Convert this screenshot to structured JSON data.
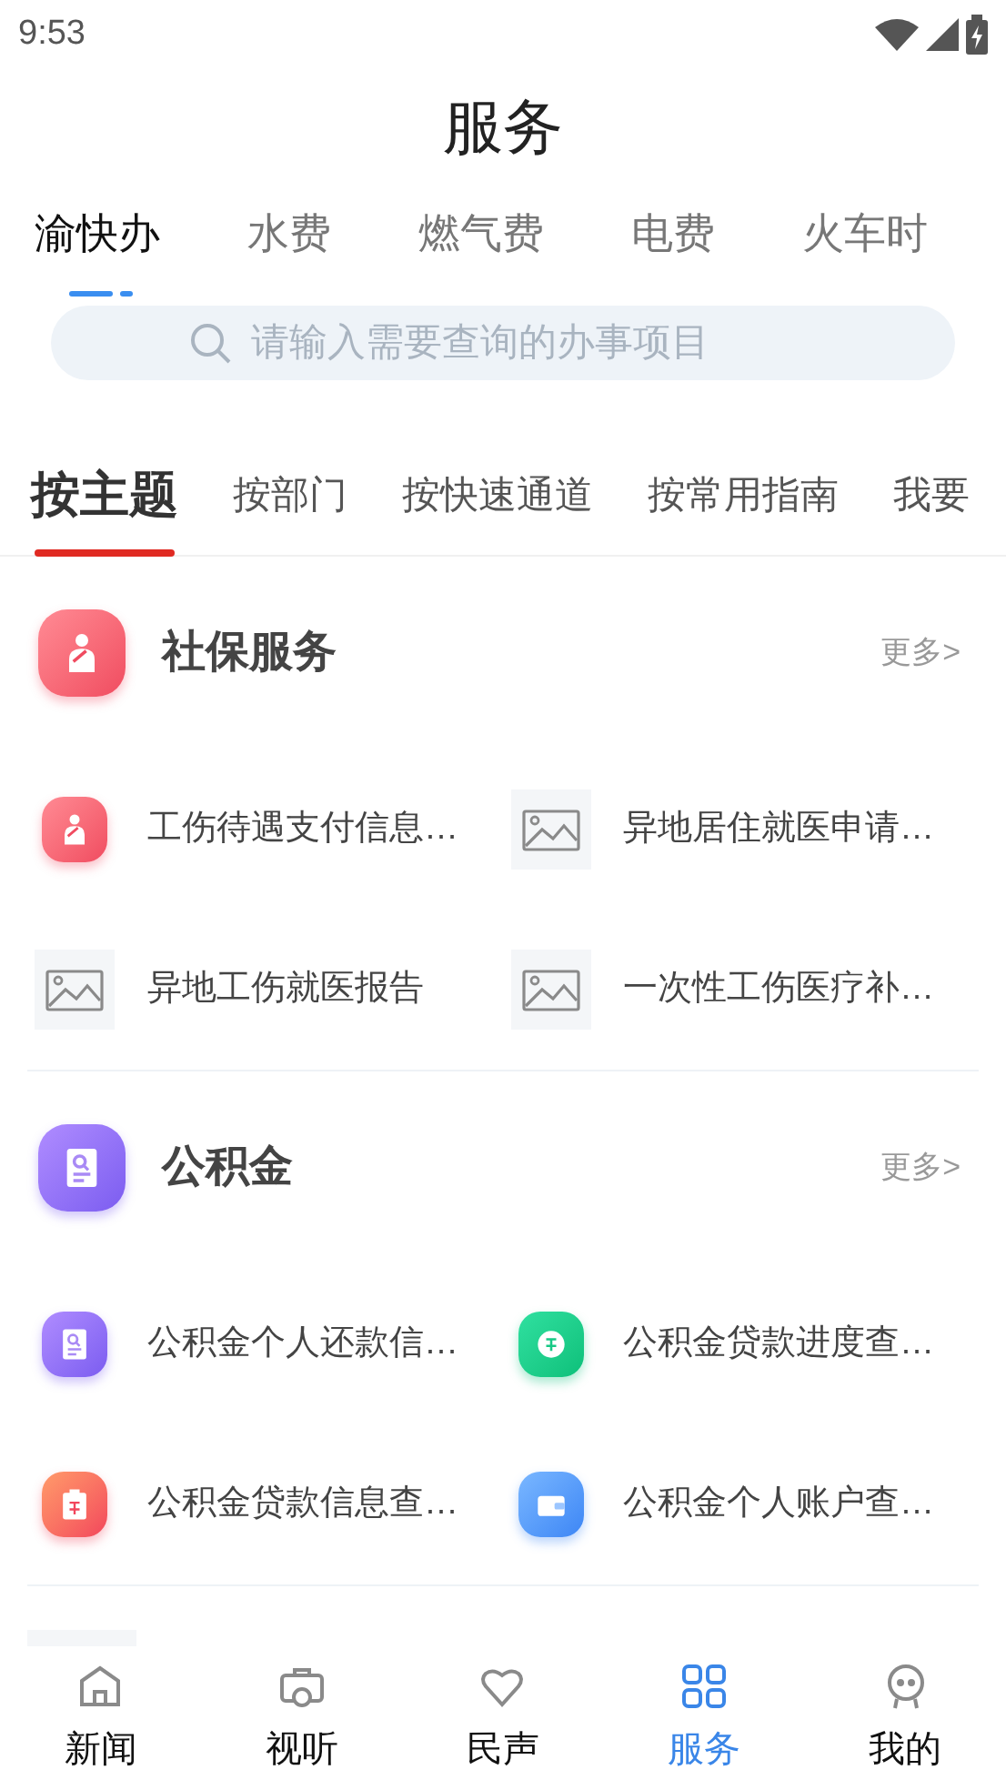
{
  "status_bar": {
    "time": "9:53"
  },
  "header": {
    "title": "服务"
  },
  "top_tabs": [
    {
      "label": "渝快办",
      "selected": true
    },
    {
      "label": "水费",
      "selected": false
    },
    {
      "label": "燃气费",
      "selected": false
    },
    {
      "label": "电费",
      "selected": false
    },
    {
      "label": "火车时",
      "selected": false
    }
  ],
  "search": {
    "placeholder": "请输入需要查询的办事项目"
  },
  "sub_tabs": [
    {
      "label": "按主题",
      "selected": true
    },
    {
      "label": "按部门",
      "selected": false
    },
    {
      "label": "按快速通道",
      "selected": false
    },
    {
      "label": "按常用指南",
      "selected": false
    },
    {
      "label": "我要",
      "selected": false
    }
  ],
  "sections": [
    {
      "title": "社保服务",
      "kind": "injury",
      "more": "更多>",
      "items": [
        {
          "label": "工伤待遇支付信息…",
          "kind": "injury"
        },
        {
          "label": "异地居住就医申请…",
          "kind": "picture"
        },
        {
          "label": "异地工伤就医报告",
          "kind": "picture"
        },
        {
          "label": "一次性工伤医疗补…",
          "kind": "picture"
        }
      ]
    },
    {
      "title": "公积金",
      "kind": "document",
      "more": "更多>",
      "items": [
        {
          "label": "公积金个人还款信…",
          "kind": "document"
        },
        {
          "label": "公积金贷款进度查…",
          "kind": "loan"
        },
        {
          "label": "公积金贷款信息查…",
          "kind": "clipboard"
        },
        {
          "label": "公积金个人账户查…",
          "kind": "wallet"
        }
      ]
    },
    {
      "kind": "picture"
    }
  ],
  "bottom_nav": [
    {
      "label": "新闻",
      "kind": "home",
      "selected": false
    },
    {
      "label": "视听",
      "kind": "camera",
      "selected": false
    },
    {
      "label": "民声",
      "kind": "heart",
      "selected": false
    },
    {
      "label": "服务",
      "kind": "grid",
      "selected": true
    },
    {
      "label": "我的",
      "kind": "face",
      "selected": false
    }
  ]
}
